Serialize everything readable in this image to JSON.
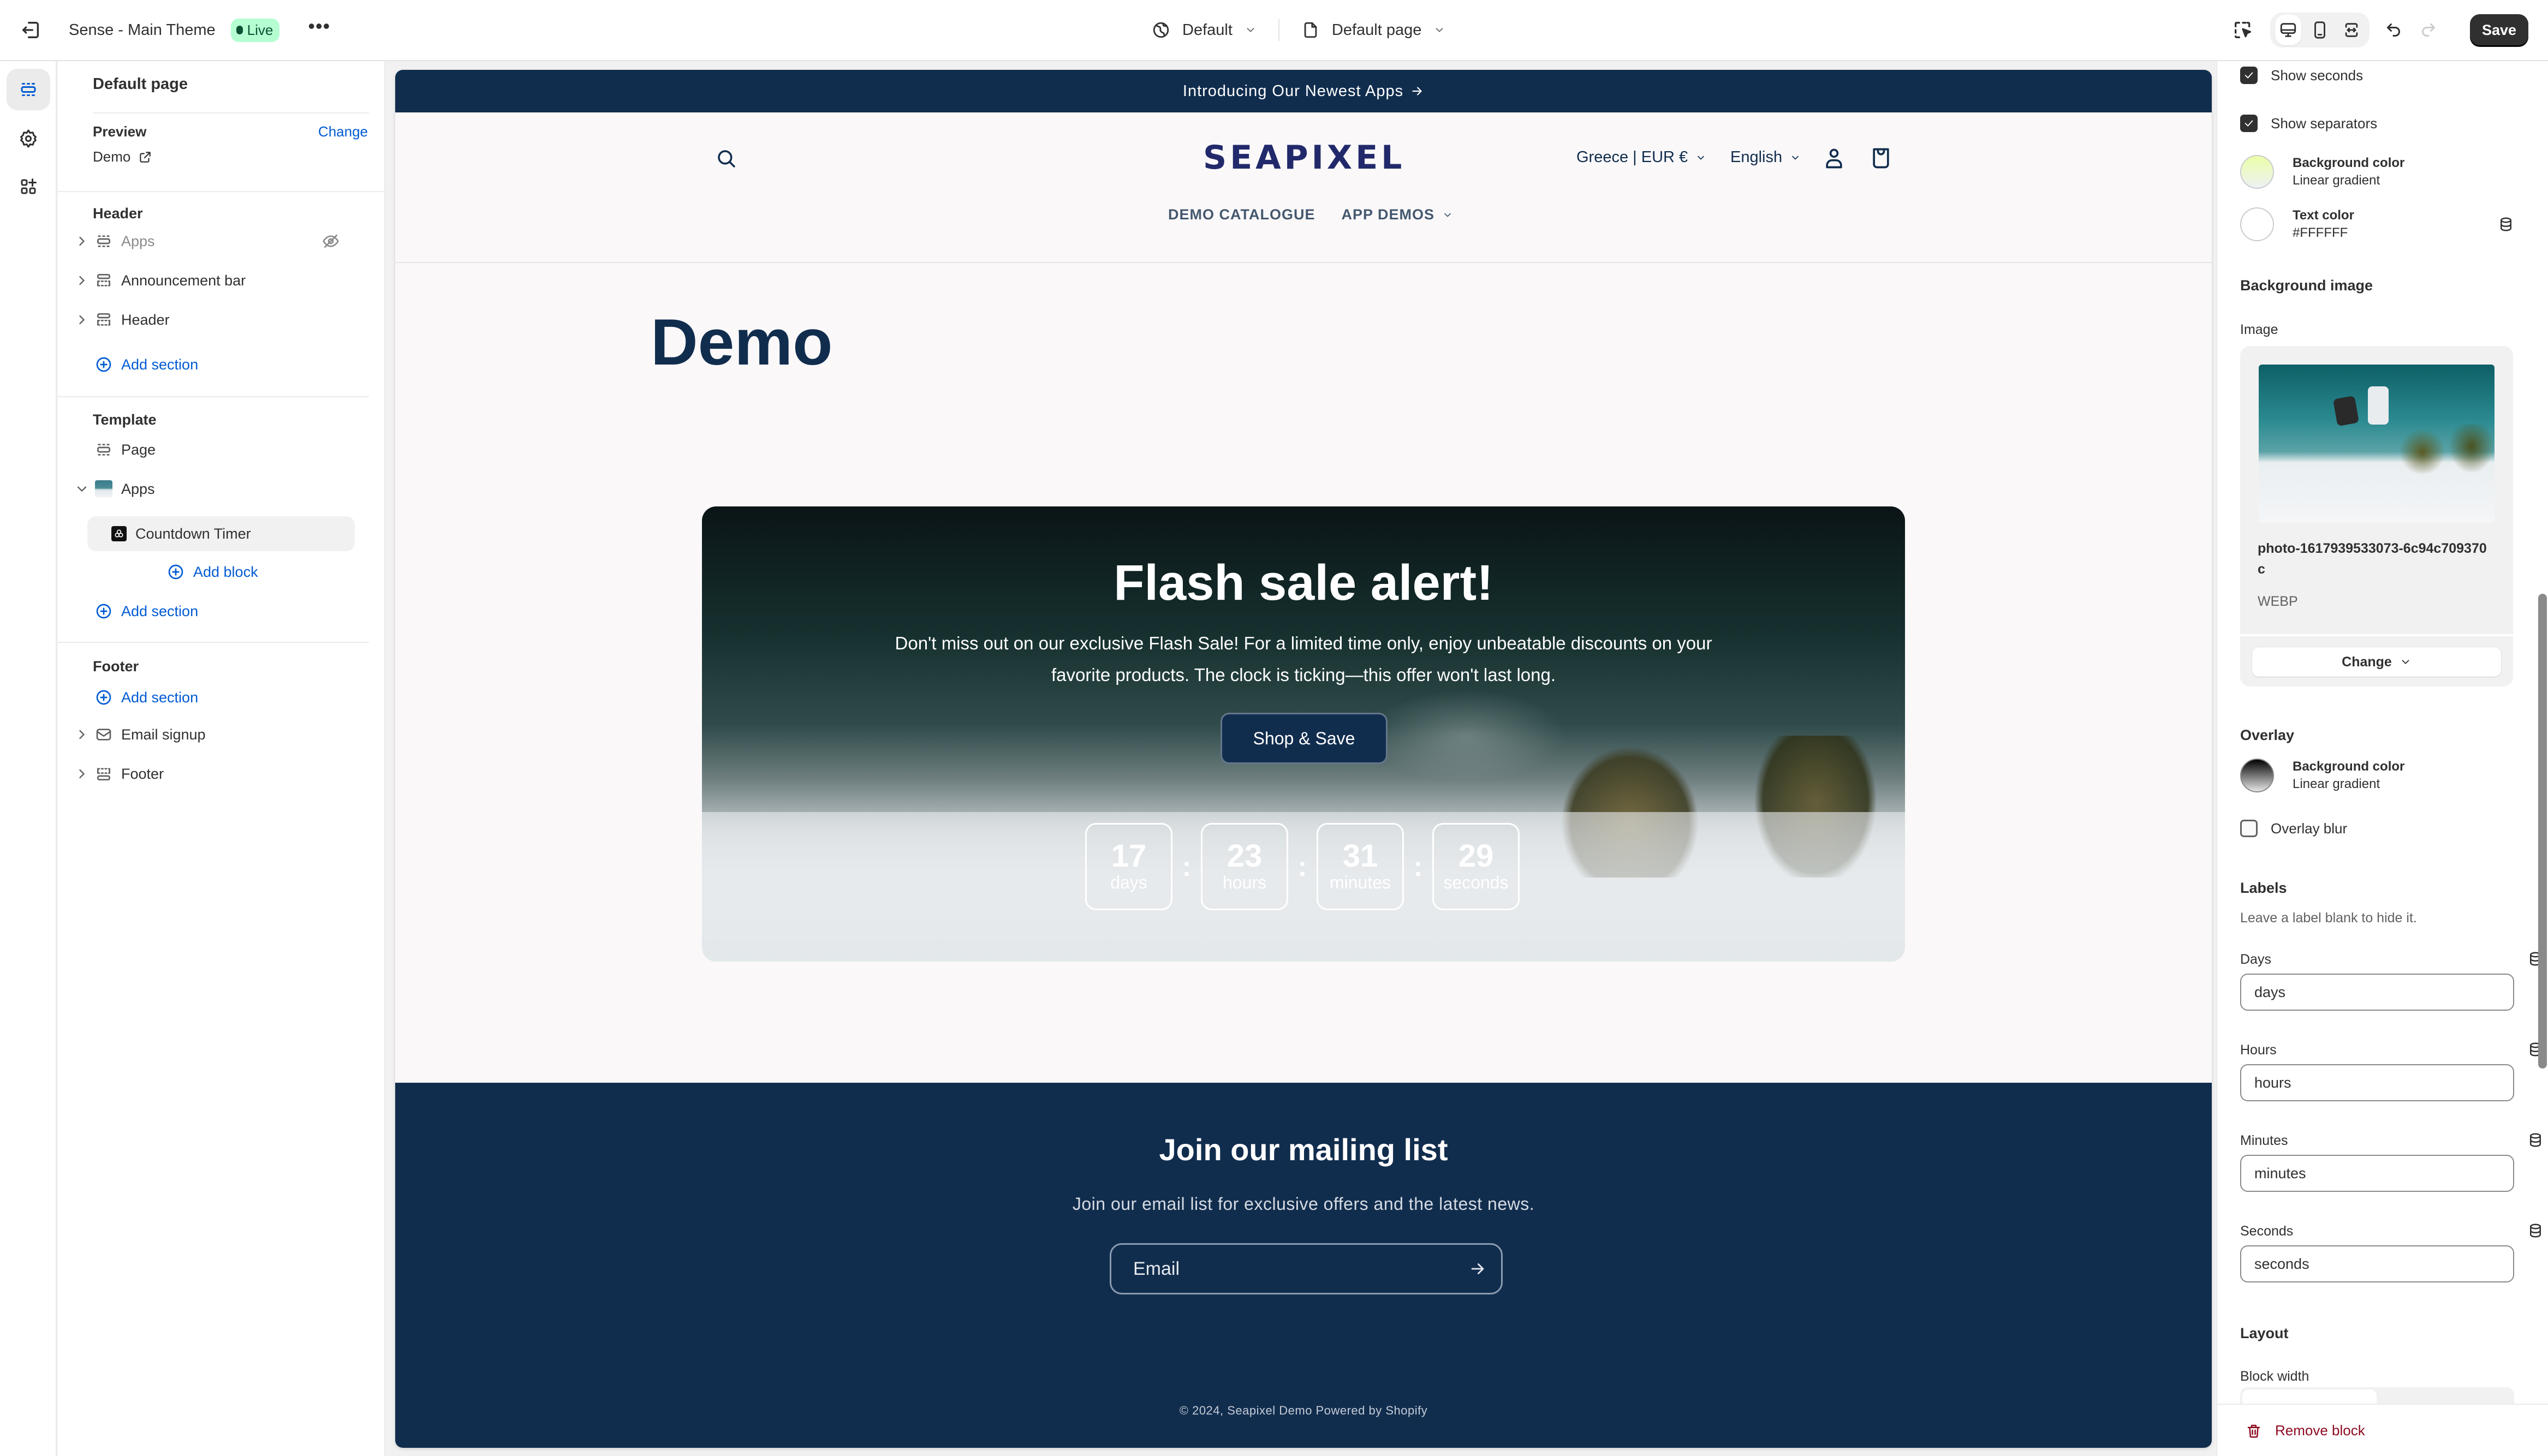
{
  "topbar": {
    "theme_name": "Sense - Main Theme",
    "status_badge": "Live",
    "status_color": "#b4fed2",
    "more_label": "•••",
    "context_select": "Default",
    "page_select": "Default page",
    "save_label": "Save"
  },
  "rail": {
    "items": [
      {
        "icon": "sections-icon",
        "active": true
      },
      {
        "icon": "gear-icon",
        "active": false
      },
      {
        "icon": "apps-add-icon",
        "active": false
      }
    ]
  },
  "sections_panel": {
    "title": "Default page",
    "preview": {
      "label": "Preview",
      "change": "Change",
      "value": "Demo"
    },
    "groups": {
      "header": {
        "title": "Header",
        "items": [
          {
            "label": "Apps",
            "hidden": true
          },
          {
            "label": "Announcement bar"
          },
          {
            "label": "Header"
          }
        ],
        "add_section": "Add section"
      },
      "template": {
        "title": "Template",
        "items": [
          {
            "label": "Page"
          },
          {
            "label": "Apps",
            "expanded": true
          }
        ],
        "blocks": [
          {
            "label": "Countdown Timer",
            "selected": true
          }
        ],
        "add_block": "Add block",
        "add_section": "Add section"
      },
      "footer": {
        "title": "Footer",
        "add_section": "Add section",
        "items": [
          {
            "label": "Email signup"
          },
          {
            "label": "Footer"
          }
        ]
      }
    }
  },
  "store": {
    "announcement": "Introducing Our Newest Apps",
    "logo": "SEAPIXEL",
    "localization": "Greece | EUR €",
    "language": "English",
    "nav": [
      "DEMO CATALOGUE",
      "APP DEMOS"
    ],
    "page_title": "Demo",
    "hero": {
      "title": "Flash sale alert!",
      "description": "Don't miss out on our exclusive Flash Sale! For a limited time only, enjoy unbeatable discounts on your favorite products. The clock is ticking—this offer won't last long.",
      "cta": "Shop & Save",
      "countdown": [
        {
          "value": "17",
          "label": "days"
        },
        {
          "value": "23",
          "label": "hours"
        },
        {
          "value": "31",
          "label": "minutes"
        },
        {
          "value": "29",
          "label": "seconds"
        }
      ],
      "separator": ":"
    },
    "newsletter": {
      "title": "Join our mailing list",
      "subtitle": "Join our email list for exclusive offers and the latest news.",
      "email_placeholder": "Email"
    },
    "copyright": "© 2024, Seapixel Demo Powered by Shopify",
    "brand_color": "#112d4e"
  },
  "settings": {
    "show_seconds": {
      "label": "Show seconds",
      "checked": true
    },
    "show_separators": {
      "label": "Show separators",
      "checked": true
    },
    "background_color": {
      "label": "Background color",
      "value": "Linear gradient"
    },
    "text_color": {
      "label": "Text color",
      "value": "#FFFFFF"
    },
    "background_image": {
      "heading": "Background image",
      "image_label": "Image",
      "file_name": "photo-1617939533073-6c94c709370c",
      "file_type": "WEBP",
      "change": "Change"
    },
    "overlay": {
      "heading": "Overlay",
      "background_color": {
        "label": "Background color",
        "value": "Linear gradient"
      },
      "blur": {
        "label": "Overlay blur",
        "checked": false
      }
    },
    "labels": {
      "heading": "Labels",
      "help": "Leave a label blank to hide it.",
      "fields": [
        {
          "label": "Days",
          "value": "days"
        },
        {
          "label": "Hours",
          "value": "hours"
        },
        {
          "label": "Minutes",
          "value": "minutes"
        },
        {
          "label": "Seconds",
          "value": "seconds"
        }
      ]
    },
    "layout": {
      "heading": "Layout",
      "block_width_label": "Block width"
    },
    "remove_block": "Remove block"
  }
}
